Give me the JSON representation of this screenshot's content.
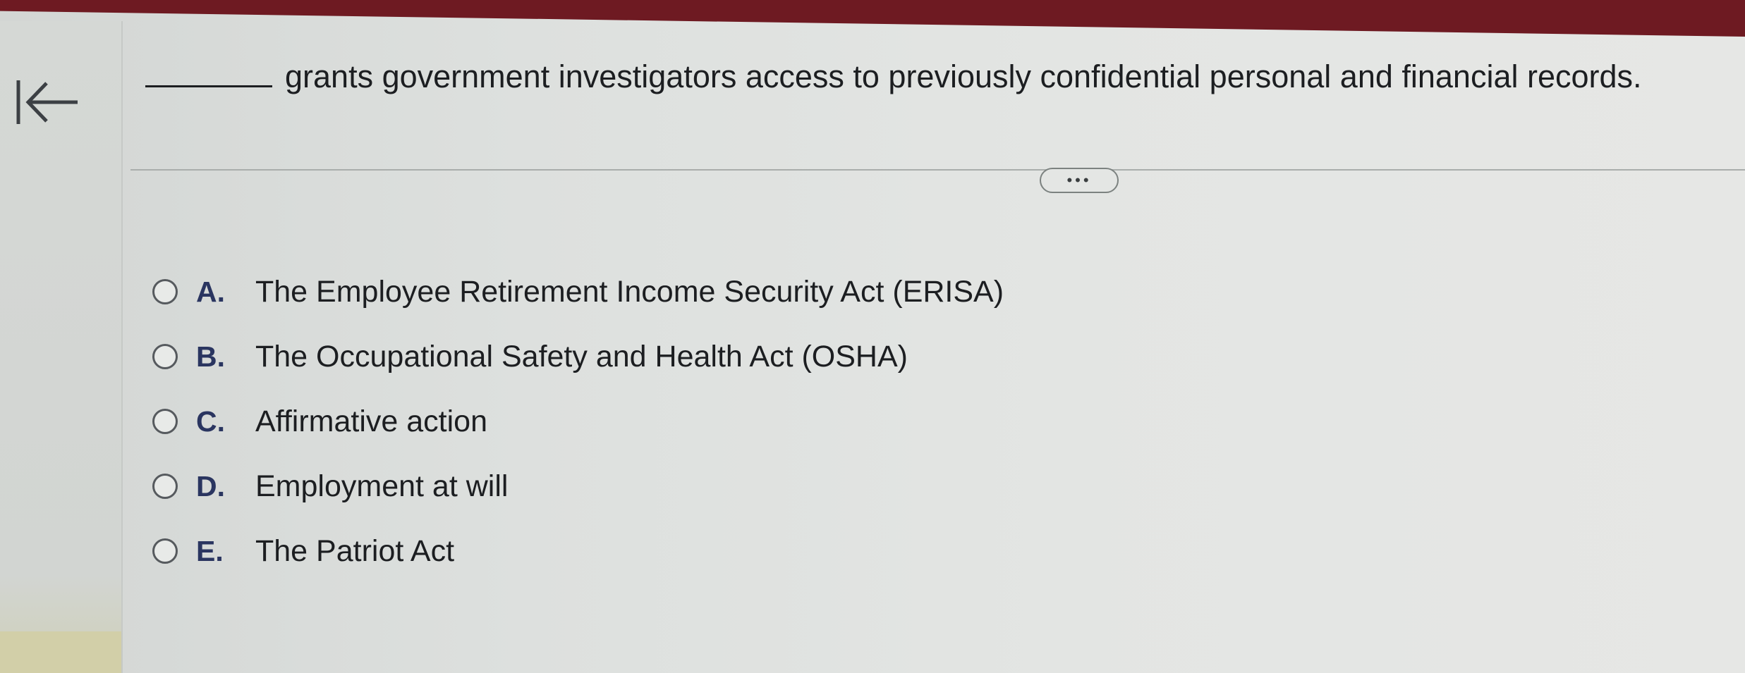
{
  "header": {
    "back_icon": "first-page-arrow-icon"
  },
  "question": {
    "blank": "______",
    "text": "grants government investigators access to previously confidential personal and financial records."
  },
  "toolbar": {
    "more_label": "•••"
  },
  "options": [
    {
      "letter": "A.",
      "text": "The Employee Retirement Income Security Act (ERISA)"
    },
    {
      "letter": "B.",
      "text": "The Occupational Safety and Health Act (OSHA)"
    },
    {
      "letter": "C.",
      "text": "Affirmative action"
    },
    {
      "letter": "D.",
      "text": "Employment at will"
    },
    {
      "letter": "E.",
      "text": "The Patriot Act"
    }
  ],
  "colors": {
    "top_bar": "#6e1a22",
    "option_letter": "#2a3560"
  }
}
